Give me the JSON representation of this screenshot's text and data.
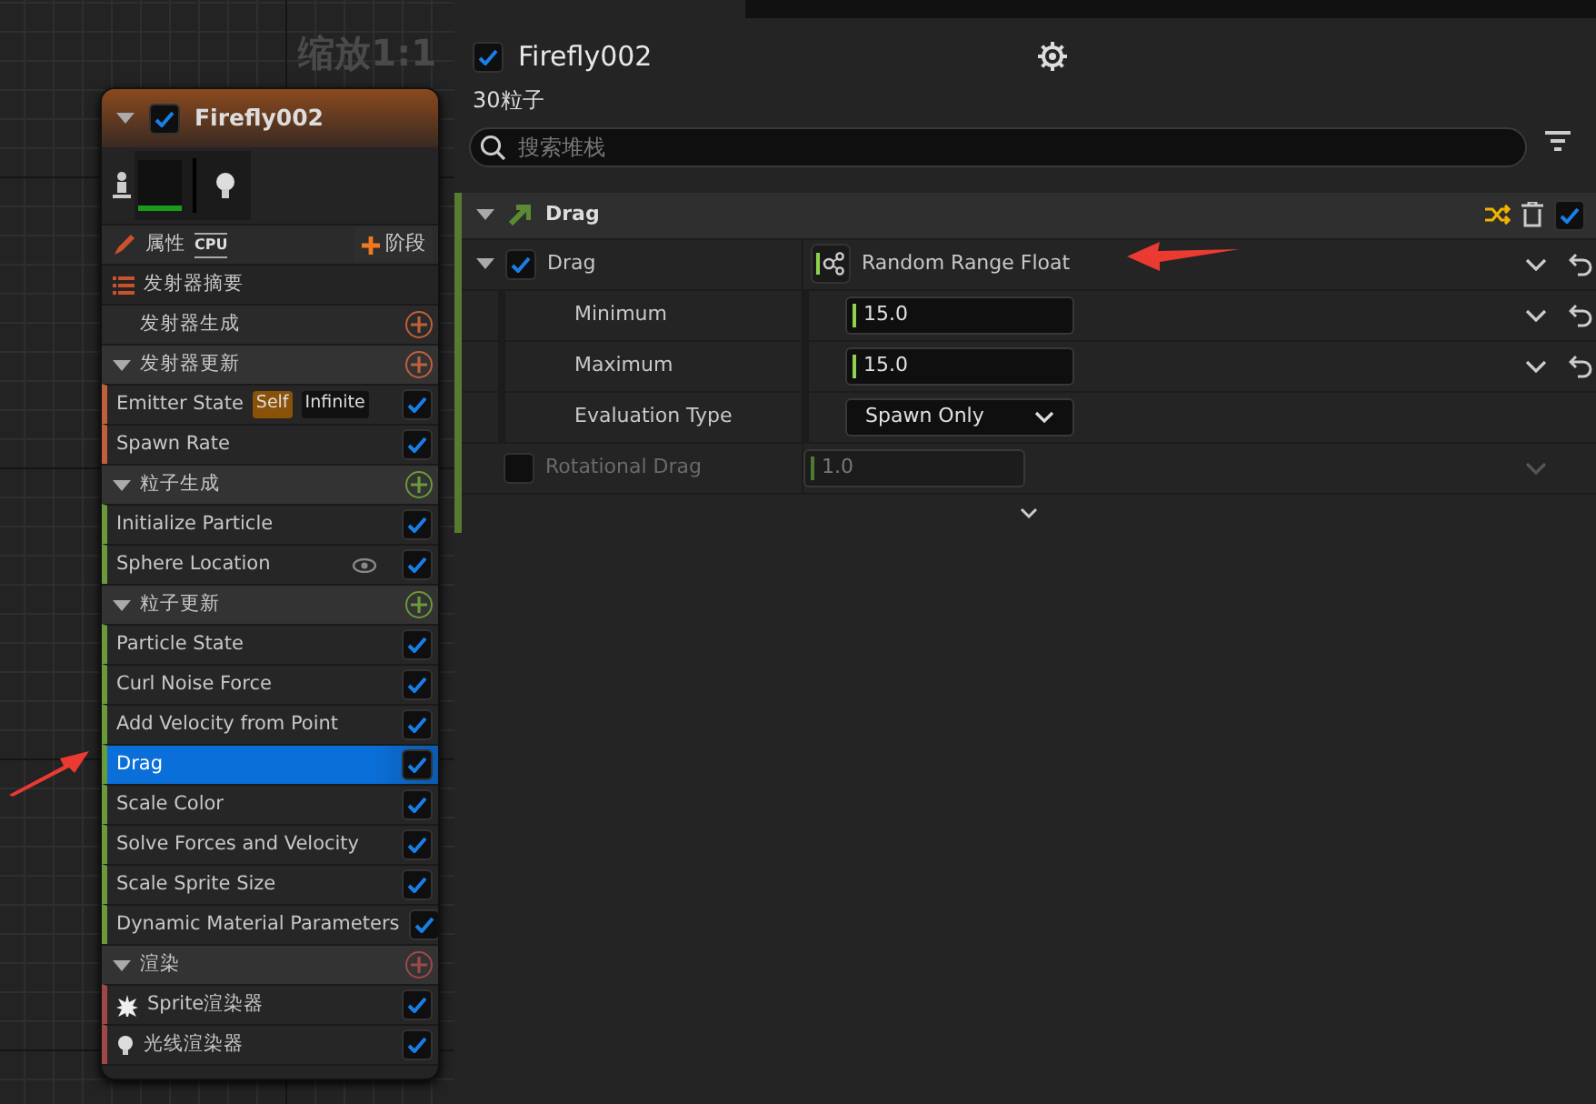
{
  "graph": {
    "zoom_label": "缩放1:1"
  },
  "emitter_node": {
    "title": "Firefly002",
    "enabled": true,
    "properties_label": "属性",
    "sim_target": "CPU",
    "stage_button": "阶段",
    "summary": "发射器摘要",
    "sections": [
      {
        "title": "发射器生成",
        "expandable": false,
        "color": "#c0603a"
      },
      {
        "title": "发射器更新",
        "expandable": true,
        "color": "#c0603a",
        "modules": [
          {
            "label": "Emitter State",
            "kind": "tagged",
            "tags": [
              {
                "text": "Self",
                "kind": "self"
              },
              {
                "text": "Infinite",
                "kind": "plain"
              }
            ],
            "enabled": true,
            "selected": false
          },
          {
            "label": "Spawn Rate",
            "kind": "plain",
            "enabled": true,
            "selected": false
          }
        ]
      },
      {
        "title": "粒子生成",
        "expandable": true,
        "color": "#6a9a3a",
        "modules": [
          {
            "label": "Initialize Particle",
            "kind": "plain",
            "enabled": true,
            "selected": false
          },
          {
            "label": "Sphere Location",
            "kind": "eye",
            "enabled": true,
            "selected": false
          }
        ]
      },
      {
        "title": "粒子更新",
        "expandable": true,
        "color": "#6a9a3a",
        "modules": [
          {
            "label": "Particle State",
            "kind": "plain",
            "enabled": true,
            "selected": false
          },
          {
            "label": "Curl Noise Force",
            "kind": "plain",
            "enabled": true,
            "selected": false
          },
          {
            "label": "Add Velocity from Point",
            "kind": "plain",
            "enabled": true,
            "selected": false
          },
          {
            "label": "Drag",
            "kind": "plain",
            "enabled": true,
            "selected": true
          },
          {
            "label": "Scale Color",
            "kind": "plain",
            "enabled": true,
            "selected": false
          },
          {
            "label": "Solve Forces and Velocity",
            "kind": "plain",
            "enabled": true,
            "selected": false
          },
          {
            "label": "Scale Sprite Size",
            "kind": "plain",
            "enabled": true,
            "selected": false
          },
          {
            "label": "Dynamic Material Parameters",
            "kind": "plain",
            "enabled": true,
            "selected": false
          }
        ]
      },
      {
        "title": "渲染",
        "expandable": true,
        "color": "#a04848",
        "modules": [
          {
            "label": "Sprite渲染器",
            "kind": "sprite",
            "enabled": true,
            "selected": false
          },
          {
            "label": "光线渲染器",
            "kind": "ribbon",
            "enabled": true,
            "selected": false
          }
        ]
      }
    ]
  },
  "details": {
    "emitter_name": "Firefly002",
    "enabled": true,
    "particle_count": "30粒子",
    "search": {
      "placeholder": "搜索堆栈"
    },
    "module": {
      "title": "Drag",
      "enabled": true,
      "rows": [
        {
          "kind": "dynamic",
          "label": "Drag",
          "checked": true,
          "value": "Random Range Float",
          "children": [
            {
              "kind": "number",
              "label": "Minimum",
              "value": "15.0"
            },
            {
              "kind": "number",
              "label": "Maximum",
              "value": "15.0"
            },
            {
              "kind": "dropdown",
              "label": "Evaluation Type",
              "value": "Spawn Only"
            }
          ]
        },
        {
          "kind": "number",
          "label": "Rotational Drag",
          "checked": false,
          "value": "1.0",
          "disabled": true
        }
      ]
    }
  }
}
